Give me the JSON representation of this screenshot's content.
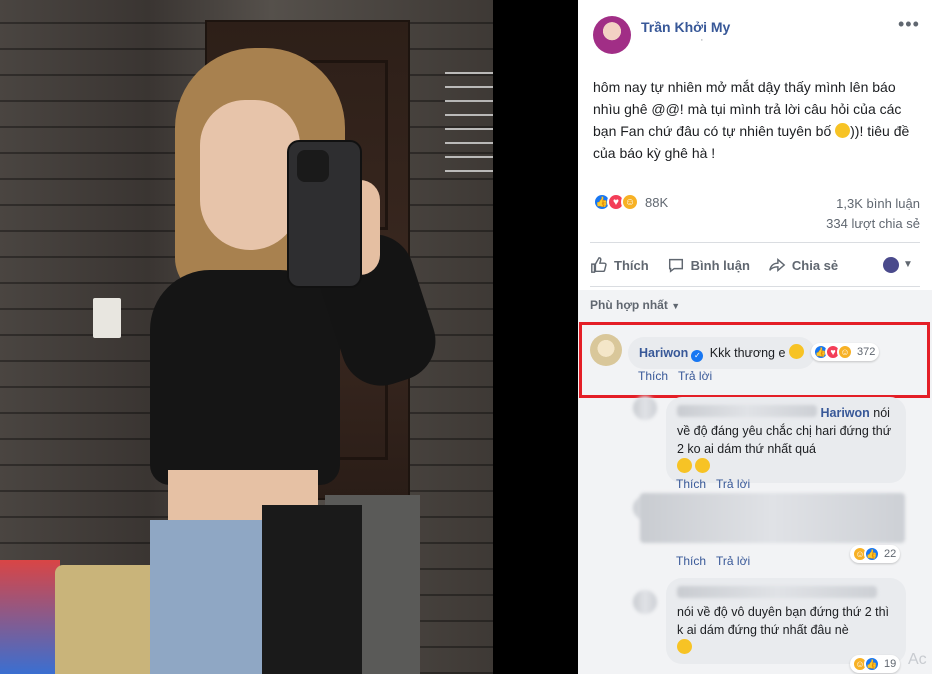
{
  "post": {
    "author": "Trần Khởi My",
    "meta_dot": "·",
    "more_icon": "ellipsis-icon",
    "text_1": "hôm nay tự nhiên mở mắt dậy thấy mình lên báo nhìu ghê @@! mà tụi mình trả lời câu hỏi của các bạn Fan chứ đâu có tự nhiên tuyên bố ",
    "text_2": "))! tiêu đề của báo kỳ ghê hà !",
    "reaction_count": "88K",
    "comment_count": "1,3K bình luận",
    "share_count": "334 lượt chia sẻ"
  },
  "actions": {
    "like": "Thích",
    "comment": "Bình luận",
    "share": "Chia sẻ"
  },
  "sort_label": "Phù hợp nhất",
  "comments": [
    {
      "name": "Hariwon",
      "text": "Kkk thương e",
      "react_count": "372",
      "like": "Thích",
      "reply": "Trả lời"
    },
    {
      "mention": "Hariwon",
      "text_a": "nói",
      "text_b": "về độ đáng yêu chắc chị hari đứng thứ 2 ko ai dám thứ nhất quá",
      "like": "Thích",
      "reply": "Trả lời"
    },
    {
      "react_count": "22",
      "like": "Thích",
      "reply": "Trả lời"
    },
    {
      "text": "nói về độ vô duyên bạn đứng thứ 2 thì k ai dám đứng thứ nhất đâu nè",
      "react_count": "19"
    }
  ],
  "watermark": "Ac",
  "colors": {
    "link": "#385898",
    "highlight": "#e41e26",
    "like_blue": "#1877f2"
  }
}
